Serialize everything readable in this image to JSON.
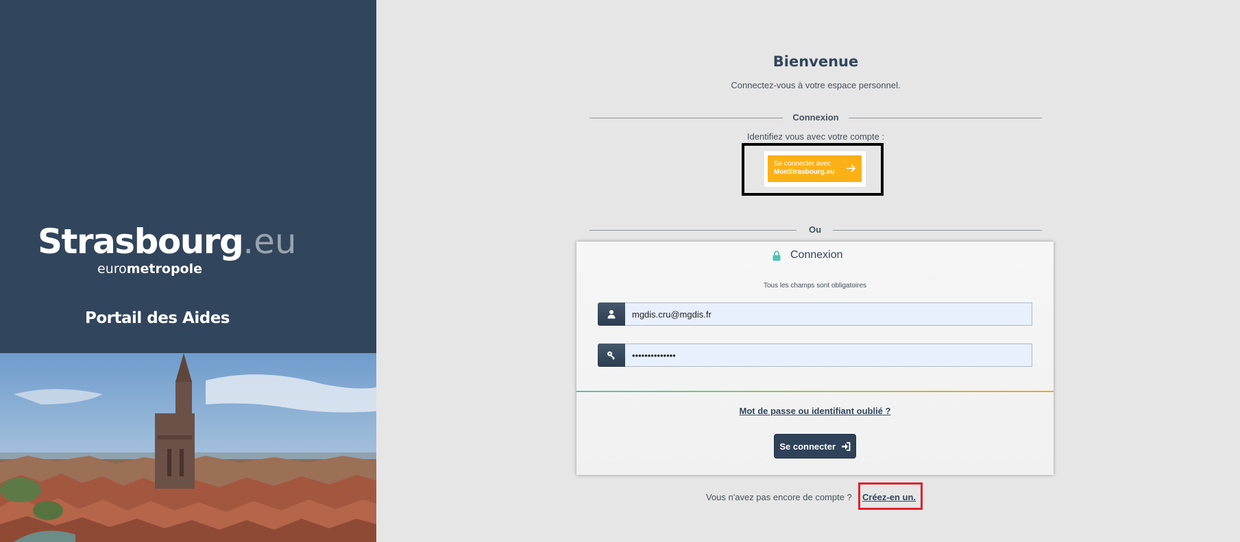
{
  "brand": {
    "logo_main": "Strasbourg",
    "logo_suffix": ".eu",
    "logo_sub_light": "euro",
    "logo_sub_strong": "metropole",
    "portal_title": "Portail des Aides"
  },
  "welcome": {
    "title": "Bienvenue",
    "subtitle": "Connectez-vous à votre espace personnel."
  },
  "sso": {
    "section_label": "Connexion",
    "prompt": "Identifiez vous avec votre compte :",
    "button_line1": "Se connecter avec",
    "button_line2": "MonStrasbourg.eu"
  },
  "or_label": "Ou",
  "login": {
    "title": "Connexion",
    "required_note": "Tous les champs sont obligatoires",
    "email_value": "mgdis.cru@mgdis.fr",
    "password_value": "••••••••••••••",
    "forgot_link": "Mot de passe ou identifiant oublié ?",
    "submit_label": "Se connecter"
  },
  "signup": {
    "text": "Vous n'avez pas encore de compte ?",
    "link": "Créez-en un."
  },
  "colors": {
    "panel": "#31455c",
    "accent": "#fbb116",
    "lock": "#4fc3b1",
    "highlight_black": "#000000",
    "highlight_red": "#e0202a"
  }
}
